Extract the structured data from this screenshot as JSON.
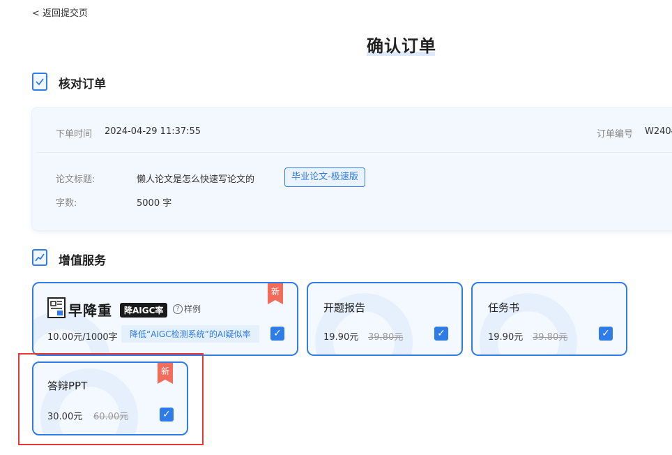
{
  "nav": {
    "back_label": "< 返回提交页"
  },
  "page": {
    "title": "确认订单"
  },
  "sections": {
    "verify": "核对订单",
    "services": "增值服务"
  },
  "order": {
    "time_label": "下单时间",
    "time_value": "2024-04-29 11:37:55",
    "number_label": "订单编号",
    "number_value": "W2404",
    "paper_title_label": "论文标题:",
    "paper_title_value": "懒人论文是怎么快速写论文的",
    "type_tag": "毕业论文-极速版",
    "word_count_label": "字数:",
    "word_count_value": "5000 字"
  },
  "services": [
    {
      "logo_text": "早降重",
      "logo_badge": "降AIGC率",
      "sample_label": "样例",
      "price": "10.00元/1000字",
      "promo": "降低“AIGC检测系统”的AI疑似率",
      "new_badge": "新",
      "checked": true
    },
    {
      "name": "开题报告",
      "price": "19.90元",
      "old_price": "39.80元",
      "checked": true
    },
    {
      "name": "任务书",
      "price": "19.90元",
      "old_price": "39.80元",
      "checked": true
    },
    {
      "name": "答辩PPT",
      "price": "30.00元",
      "old_price": "60.00元",
      "new_badge": "新",
      "checked": true
    }
  ],
  "icons": {
    "checkbox": "check-icon",
    "verify": "document-check-icon",
    "services": "chart-trend-icon"
  },
  "colors": {
    "accent": "#2f7be8",
    "highlight_frame": "#e53935",
    "new_badge": "#f26b5b"
  }
}
